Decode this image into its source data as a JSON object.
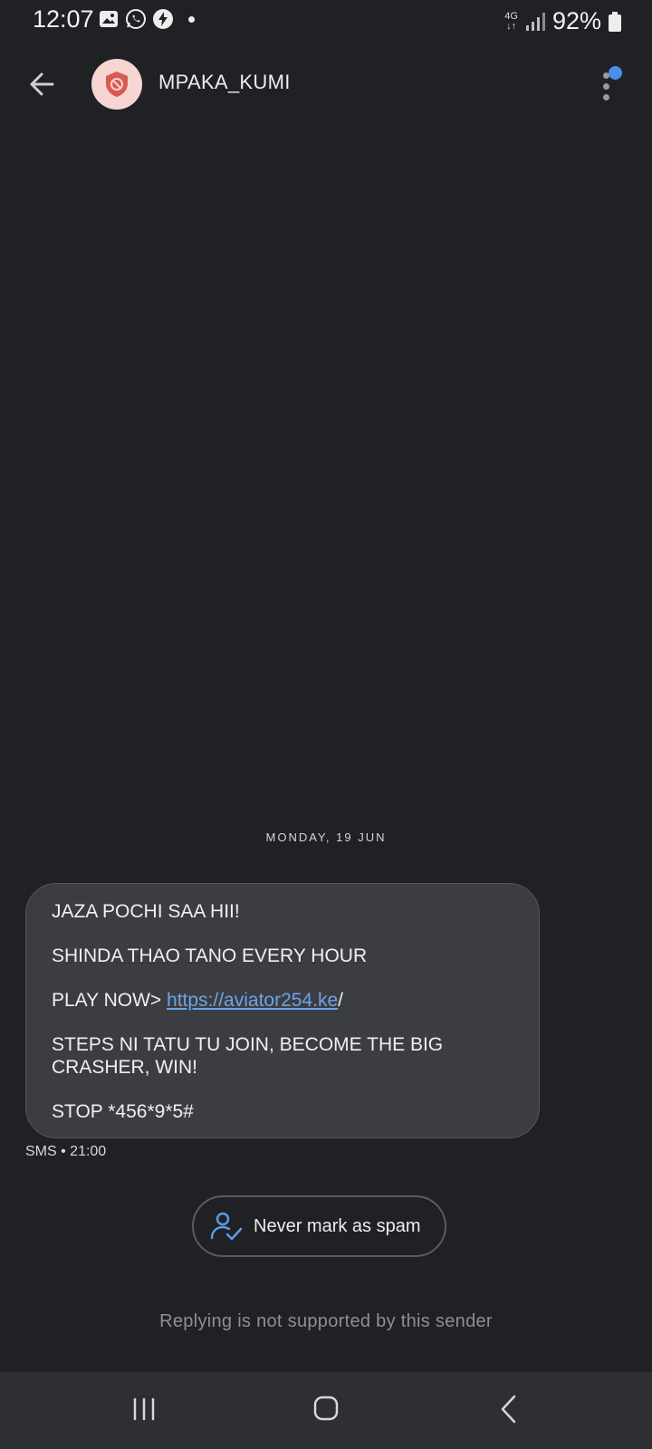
{
  "status_bar": {
    "time": "12:07",
    "network": "4G",
    "battery": "92%",
    "icons": [
      "gallery-icon",
      "whatsapp-icon",
      "bolt-icon",
      "dot-icon",
      "signal-icon",
      "battery-icon"
    ]
  },
  "header": {
    "contact_name": "MPAKA_KUMI",
    "avatar_icon": "spam-shield-icon",
    "accent_color": "#4A8EE6"
  },
  "conversation": {
    "date_separator": "MONDAY, 19 JUN",
    "message": {
      "line1": "JAZA POCHI SAA HII!",
      "line2": "SHINDA THAO TANO EVERY HOUR",
      "line3_prefix": "PLAY NOW> ",
      "line3_link": "https://aviator254.ke",
      "line3_suffix": "/",
      "line4": "STEPS NI TATU TU JOIN, BECOME THE BIG CRASHER, WIN!",
      "line5": "STOP *456*9*5#"
    },
    "meta": "SMS • 21:00"
  },
  "actions": {
    "never_spam_label": "Never mark as spam",
    "reply_note": "Replying is not supported by this sender"
  },
  "nav_bar": {
    "icons": [
      "recent-apps-icon",
      "home-icon",
      "back-icon"
    ]
  }
}
